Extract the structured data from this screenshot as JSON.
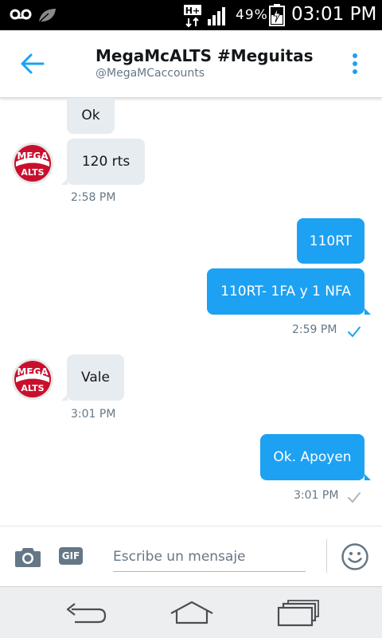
{
  "status_bar": {
    "network": "H+",
    "battery": "49%",
    "time": "03:01 PM"
  },
  "header": {
    "title": "MegaMcALTS #Meguitas",
    "handle": "@MegaMCaccounts"
  },
  "avatar": {
    "line1": "MEGA",
    "line2": "MC",
    "line3": "ALTS"
  },
  "messages": [
    {
      "direction": "in",
      "text": "Ok"
    },
    {
      "direction": "in",
      "text": "120 rts",
      "time": "2:58 PM"
    },
    {
      "direction": "out",
      "text": "110RT"
    },
    {
      "direction": "out",
      "text": "110RT- 1FA y 1 NFA",
      "time": "2:59 PM",
      "status": "read"
    },
    {
      "direction": "in",
      "text": "Vale",
      "time": "3:01 PM"
    },
    {
      "direction": "out",
      "text": "Ok. Apoyen",
      "time": "3:01 PM",
      "status": "sent"
    }
  ],
  "composer": {
    "gif_label": "GIF",
    "placeholder": "Escribe un mensaje"
  },
  "colors": {
    "accent": "#1da1f2",
    "incoming_bubble": "#e6ecf0",
    "muted": "#657786",
    "avatar_red": "#c8102e"
  },
  "icons": {
    "header": [
      "back-arrow-icon",
      "more-vert-icon"
    ],
    "composer": [
      "camera-icon",
      "gif-icon",
      "emoji-icon"
    ],
    "nav": [
      "nav-back-icon",
      "nav-home-icon",
      "nav-recent-icon"
    ]
  }
}
